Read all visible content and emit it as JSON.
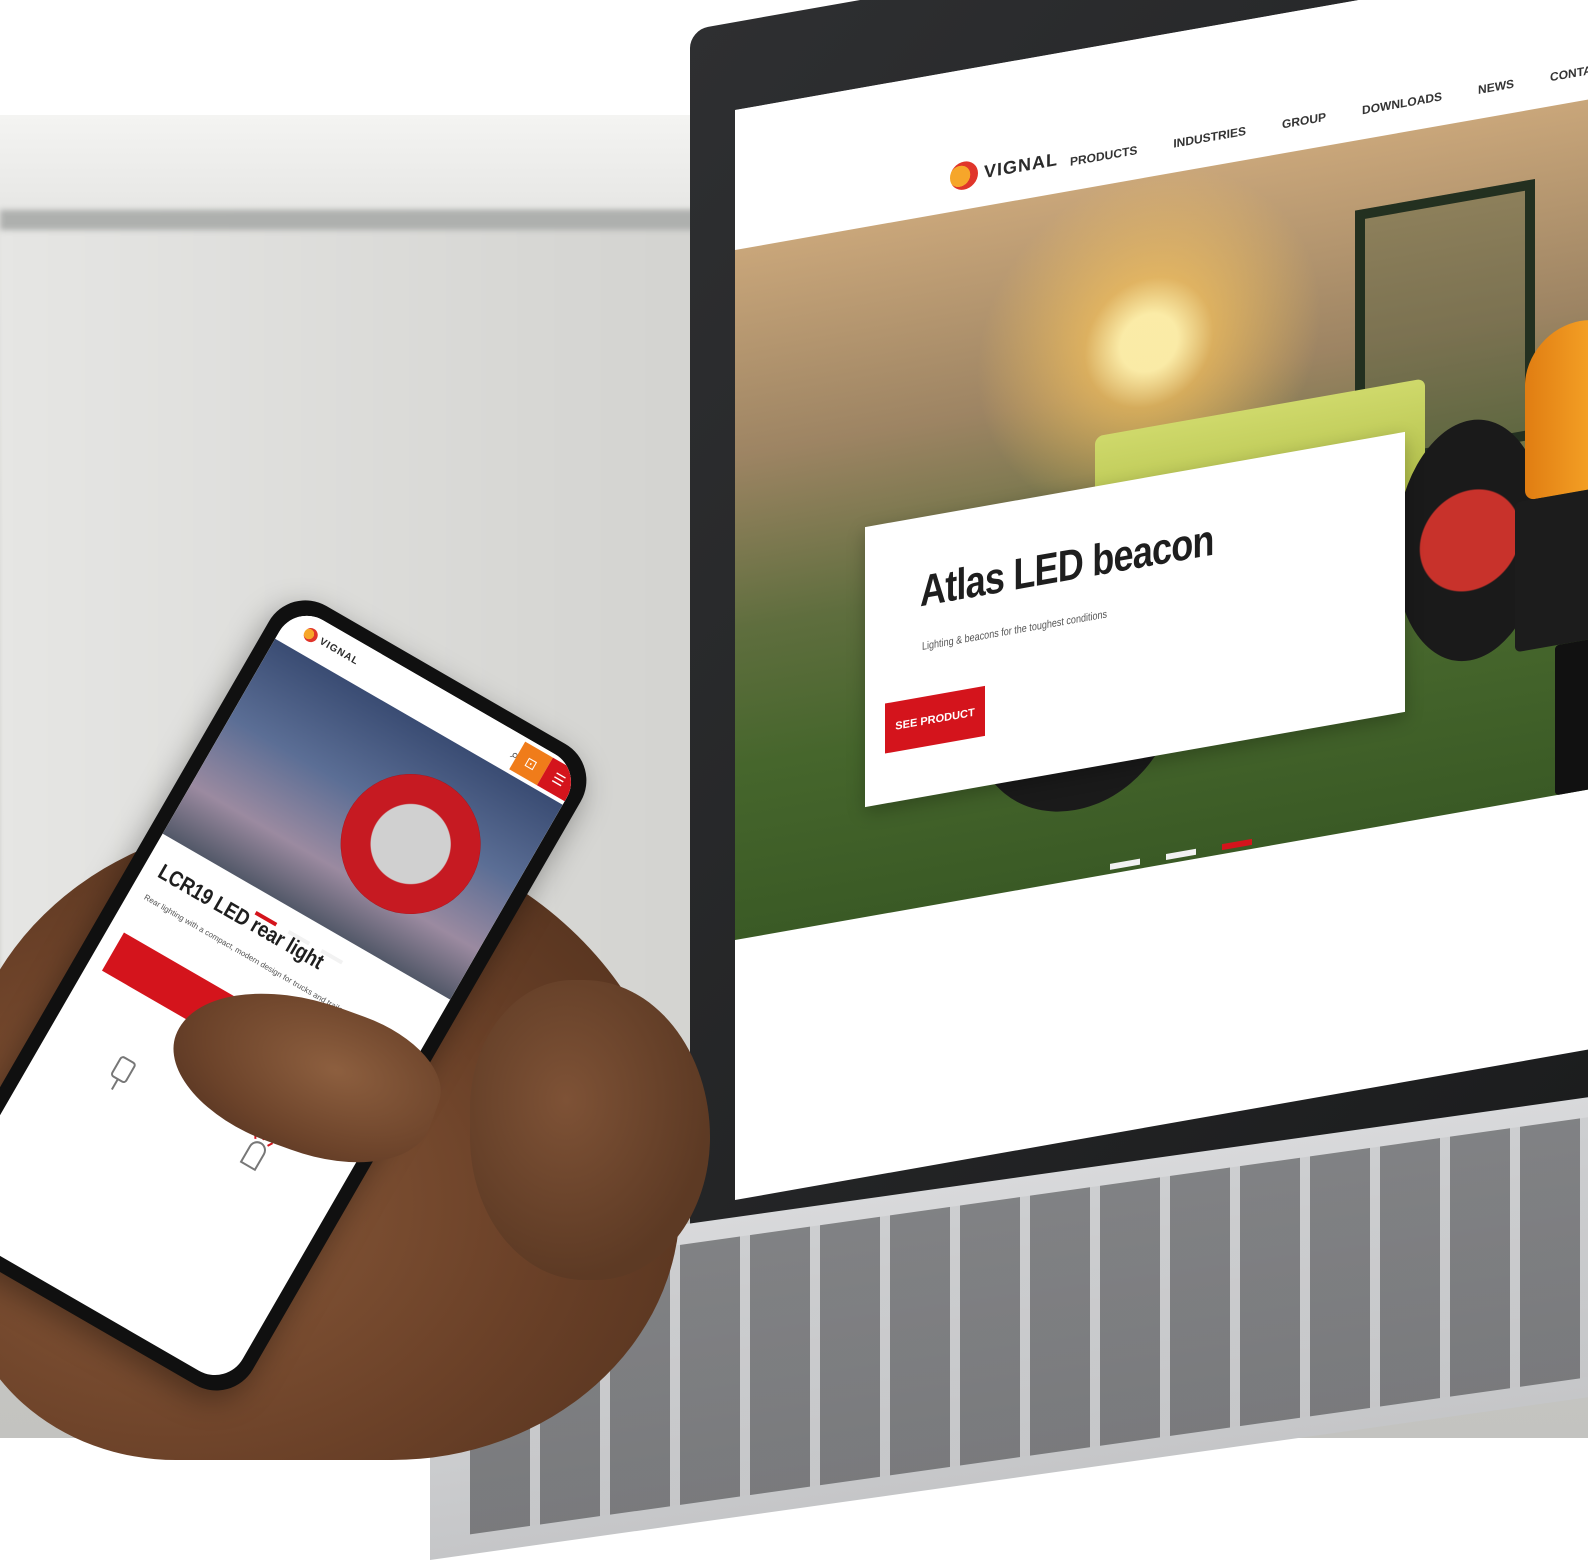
{
  "laptop": {
    "brand": "VIGNAL",
    "nav": [
      "PRODUCTS",
      "INDUSTRIES",
      "GROUP",
      "DOWNLOADS",
      "NEWS",
      "CONTACT"
    ],
    "hero_title": "Atlas LED beacon",
    "hero_subtitle": "Lighting & beacons for the toughest conditions",
    "hero_button": "SEE PRODUCT",
    "slides": 3,
    "active_slide": 3
  },
  "phone": {
    "brand": "VIGNAL",
    "hero_title": "LCR19 LED rear light",
    "hero_desc": "Rear lighting with a compact, modern design for trucks and trailers",
    "hero_button": "SEE PRODUCT",
    "slides": 3,
    "active_slide": 1
  },
  "colors": {
    "brand_red": "#d4141c",
    "brand_orange": "#f07c1a"
  },
  "icons": [
    "search-icon",
    "cart-icon",
    "menu-icon",
    "beacon-icon",
    "lamp-icon"
  ]
}
